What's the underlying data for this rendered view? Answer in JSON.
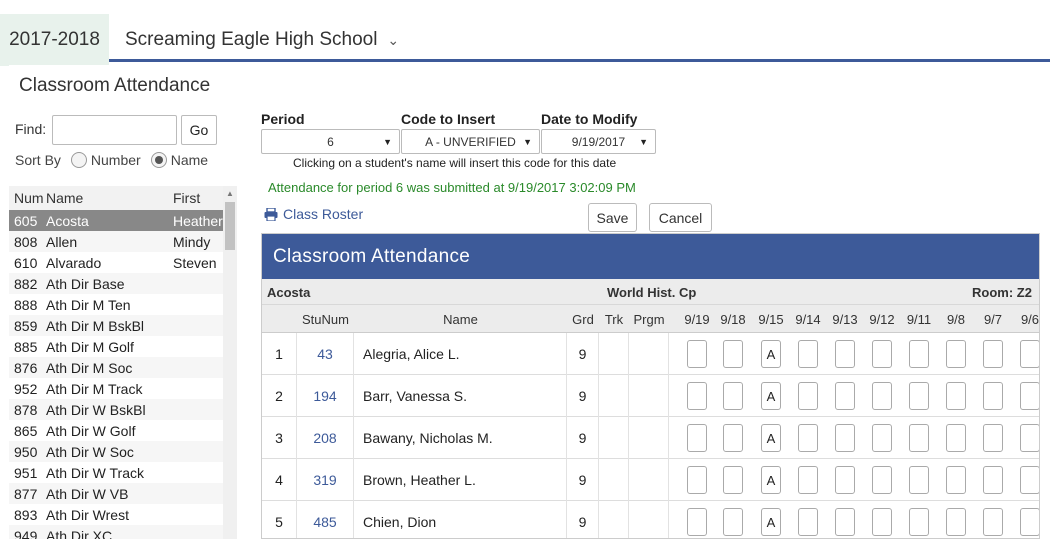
{
  "topbar": {
    "year": "2017-2018",
    "school": "Screaming Eagle High School"
  },
  "page_title": "Classroom Attendance",
  "find": {
    "label": "Find:",
    "value": "",
    "go_label": "Go"
  },
  "sort": {
    "label": "Sort By",
    "options": [
      "Number",
      "Name"
    ],
    "selected": "Name"
  },
  "student_list": {
    "headers": {
      "num": "Num",
      "name": "Name",
      "first": "First"
    },
    "rows": [
      {
        "num": "605",
        "name": "Acosta",
        "first": "Heather"
      },
      {
        "num": "808",
        "name": "Allen",
        "first": "Mindy"
      },
      {
        "num": "610",
        "name": "Alvarado",
        "first": "Steven"
      },
      {
        "num": "882",
        "name": "Ath Dir Base",
        "first": ""
      },
      {
        "num": "888",
        "name": "Ath Dir M Ten",
        "first": ""
      },
      {
        "num": "859",
        "name": "Ath Dir M BskBl",
        "first": ""
      },
      {
        "num": "885",
        "name": "Ath Dir M Golf",
        "first": ""
      },
      {
        "num": "876",
        "name": "Ath Dir M Soc",
        "first": ""
      },
      {
        "num": "952",
        "name": "Ath Dir M Track",
        "first": ""
      },
      {
        "num": "878",
        "name": "Ath Dir W BskBl",
        "first": ""
      },
      {
        "num": "865",
        "name": "Ath Dir W Golf",
        "first": ""
      },
      {
        "num": "950",
        "name": "Ath Dir W Soc",
        "first": ""
      },
      {
        "num": "951",
        "name": "Ath Dir W Track",
        "first": ""
      },
      {
        "num": "877",
        "name": "Ath Dir W VB",
        "first": ""
      },
      {
        "num": "893",
        "name": "Ath Dir Wrest",
        "first": ""
      },
      {
        "num": "949",
        "name": "Ath Dir XC",
        "first": ""
      }
    ]
  },
  "controls": {
    "period": {
      "label": "Period",
      "value": "6"
    },
    "code": {
      "label": "Code to Insert",
      "value": "A - UNVERIFIED"
    },
    "date": {
      "label": "Date to Modify",
      "value": "9/19/2017"
    },
    "hint": "Clicking on a student's name will insert this code for this date",
    "submitted": "Attendance for period 6 was submitted at 9/19/2017 3:02:09 PM",
    "roster_link": "Class Roster",
    "save_label": "Save",
    "cancel_label": "Cancel"
  },
  "panel": {
    "title": "Classroom Attendance",
    "teacher": "Acosta",
    "course": "World Hist. Cp",
    "room": "Room: Z2",
    "columns": [
      "StuNum",
      "Name",
      "Grd",
      "Trk",
      "Prgm",
      "9/19",
      "9/18",
      "9/15",
      "9/14",
      "9/13",
      "9/12",
      "9/11",
      "9/8",
      "9/7",
      "9/6"
    ],
    "rows": [
      {
        "idx": "1",
        "stunum": "43",
        "name": "Alegria, Alice L.",
        "grd": "9",
        "days": [
          "",
          "",
          "A",
          "",
          "",
          "",
          "",
          "",
          "",
          ""
        ]
      },
      {
        "idx": "2",
        "stunum": "194",
        "name": "Barr, Vanessa S.",
        "grd": "9",
        "days": [
          "",
          "",
          "A",
          "",
          "",
          "",
          "",
          "",
          "",
          ""
        ]
      },
      {
        "idx": "3",
        "stunum": "208",
        "name": "Bawany, Nicholas M.",
        "grd": "9",
        "days": [
          "",
          "",
          "A",
          "",
          "",
          "",
          "",
          "",
          "",
          ""
        ]
      },
      {
        "idx": "4",
        "stunum": "319",
        "name": "Brown, Heather L.",
        "grd": "9",
        "days": [
          "",
          "",
          "A",
          "",
          "",
          "",
          "",
          "",
          "",
          ""
        ]
      },
      {
        "idx": "5",
        "stunum": "485",
        "name": "Chien, Dion",
        "grd": "9",
        "days": [
          "",
          "",
          "A",
          "",
          "",
          "",
          "",
          "",
          "",
          ""
        ]
      }
    ]
  }
}
